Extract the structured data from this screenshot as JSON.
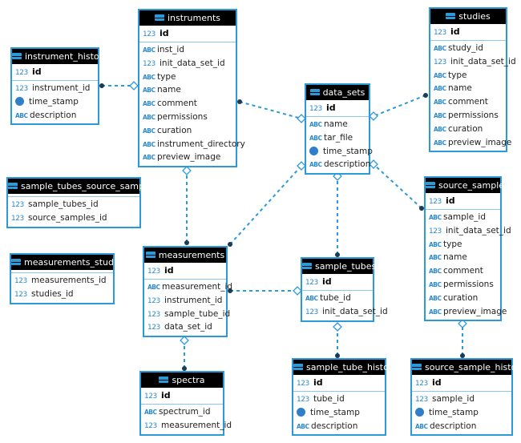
{
  "colors": {
    "border": "#2c9ad8",
    "header": "#000000",
    "edge": "#2c9ad8"
  },
  "tables": [
    {
      "id": "instruments",
      "name": "instruments",
      "pk": "id",
      "fields": [
        [
          "str-key",
          "inst_id"
        ],
        [
          "num-fk",
          "init_data_set_id"
        ],
        [
          "abc",
          "type"
        ],
        [
          "abc",
          "name"
        ],
        [
          "abc",
          "comment"
        ],
        [
          "abc",
          "permissions"
        ],
        [
          "abc",
          "curation"
        ],
        [
          "abc",
          "instrument_directory"
        ],
        [
          "abc",
          "preview_image"
        ]
      ]
    },
    {
      "id": "instrument_history",
      "name": "instrument_history",
      "pk": "id",
      "fields": [
        [
          "num-fk",
          "instrument_id"
        ],
        [
          "clock",
          "time_stamp"
        ],
        [
          "abc",
          "description"
        ]
      ]
    },
    {
      "id": "studies",
      "name": "studies",
      "pk": "id",
      "fields": [
        [
          "str-key",
          "study_id"
        ],
        [
          "num-fk",
          "init_data_set_id"
        ],
        [
          "abc",
          "type"
        ],
        [
          "abc",
          "name"
        ],
        [
          "abc",
          "comment"
        ],
        [
          "abc",
          "permissions"
        ],
        [
          "abc",
          "curation"
        ],
        [
          "abc",
          "preview_image"
        ]
      ]
    },
    {
      "id": "data_sets",
      "name": "data_sets",
      "pk": "id",
      "fields": [
        [
          "abc",
          "name"
        ],
        [
          "str-key",
          "tar_file"
        ],
        [
          "clock",
          "time_stamp"
        ],
        [
          "abc",
          "description"
        ]
      ]
    },
    {
      "id": "sample_tubes_source_samples",
      "name": "sample_tubes_source_samples",
      "pk": "",
      "fields": [
        [
          "num",
          "sample_tubes_id"
        ],
        [
          "num",
          "source_samples_id"
        ]
      ]
    },
    {
      "id": "measurements_studies",
      "name": "measurements_studies",
      "pk": "",
      "fields": [
        [
          "num",
          "measurements_id"
        ],
        [
          "num",
          "studies_id"
        ]
      ]
    },
    {
      "id": "measurements",
      "name": "measurements",
      "pk": "id",
      "fields": [
        [
          "str-key",
          "measurement_id"
        ],
        [
          "num-fk",
          "instrument_id"
        ],
        [
          "num-fk",
          "sample_tube_id"
        ],
        [
          "num-fk",
          "data_set_id"
        ]
      ]
    },
    {
      "id": "sample_tubes",
      "name": "sample_tubes",
      "pk": "id",
      "fields": [
        [
          "str-key",
          "tube_id"
        ],
        [
          "num-fk",
          "init_data_set_id"
        ]
      ]
    },
    {
      "id": "source_samples",
      "name": "source_samples",
      "pk": "id",
      "fields": [
        [
          "str-key",
          "sample_id"
        ],
        [
          "num-fk",
          "init_data_set_id"
        ],
        [
          "abc",
          "type"
        ],
        [
          "abc",
          "name"
        ],
        [
          "abc",
          "comment"
        ],
        [
          "abc",
          "permissions"
        ],
        [
          "abc",
          "curation"
        ],
        [
          "abc",
          "preview_image"
        ]
      ]
    },
    {
      "id": "spectra",
      "name": "spectra",
      "pk": "id",
      "fields": [
        [
          "str-key",
          "spectrum_id"
        ],
        [
          "num-fk",
          "measurement_id"
        ]
      ]
    },
    {
      "id": "sample_tube_history",
      "name": "sample_tube_history",
      "pk": "id",
      "fields": [
        [
          "num-fk",
          "tube_id"
        ],
        [
          "clock",
          "time_stamp"
        ],
        [
          "abc",
          "description"
        ]
      ]
    },
    {
      "id": "source_sample_history",
      "name": "source_sample_history",
      "pk": "id",
      "fields": [
        [
          "num-fk",
          "sample_id"
        ],
        [
          "clock",
          "time_stamp"
        ],
        [
          "abc",
          "description"
        ]
      ]
    }
  ],
  "relationships": [
    {
      "from": "instrument_history",
      "to": "instruments"
    },
    {
      "from": "instruments",
      "to": "data_sets"
    },
    {
      "from": "studies",
      "to": "data_sets"
    },
    {
      "from": "measurements",
      "to": "instruments"
    },
    {
      "from": "measurements",
      "to": "data_sets"
    },
    {
      "from": "sample_tubes",
      "to": "data_sets"
    },
    {
      "from": "source_samples",
      "to": "data_sets"
    },
    {
      "from": "measurements",
      "to": "sample_tubes"
    },
    {
      "from": "spectra",
      "to": "measurements"
    },
    {
      "from": "sample_tube_history",
      "to": "sample_tubes"
    },
    {
      "from": "source_sample_history",
      "to": "source_samples"
    }
  ]
}
